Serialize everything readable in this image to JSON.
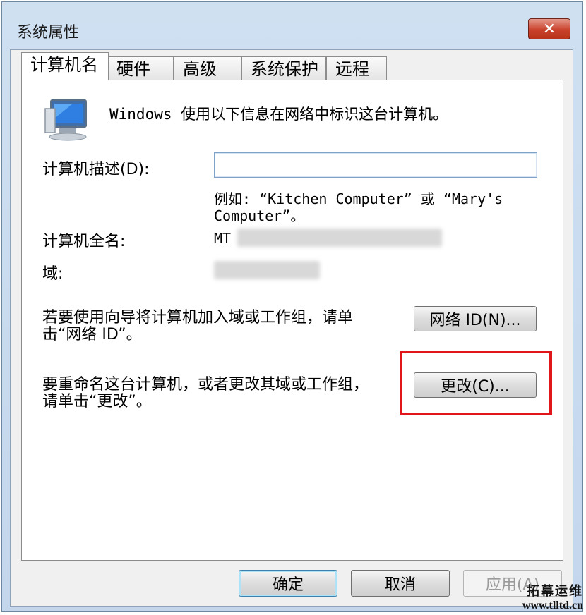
{
  "window": {
    "title": "系统属性",
    "close_glyph": "✕"
  },
  "tabs": [
    {
      "label": "计算机名",
      "active": true
    },
    {
      "label": "硬件"
    },
    {
      "label": "高级"
    },
    {
      "label": "系统保护"
    },
    {
      "label": "远程"
    }
  ],
  "panel": {
    "intro": "Windows 使用以下信息在网络中标识这台计算机。",
    "description_label": "计算机描述(D):",
    "description_value": "",
    "example_line1": "例如: “Kitchen Computer” 或 “Mary's",
    "example_line2": "Computer”。",
    "full_name_label": "计算机全名:",
    "full_name_value_visible": "MT",
    "domain_label": "域:",
    "network_id_text_line1": "若要使用向导将计算机加入域或工作组，请单",
    "network_id_text_line2": "击“网络 ID”。",
    "network_id_button": "网络 ID(N)...",
    "rename_text_line1": "要重命名这台计算机，或者更改其域或工作组，",
    "rename_text_line2": "请单击“更改”。",
    "change_button": "更改(C)..."
  },
  "footer": {
    "ok_label": "确定",
    "cancel_label": "取消",
    "apply_label": "应用(A)"
  },
  "watermark": {
    "line1": "拓幕运维",
    "line2": "www.tlltd.cn"
  },
  "colors": {
    "highlight_box": "#e0161a",
    "close_button": "#c9412b"
  }
}
